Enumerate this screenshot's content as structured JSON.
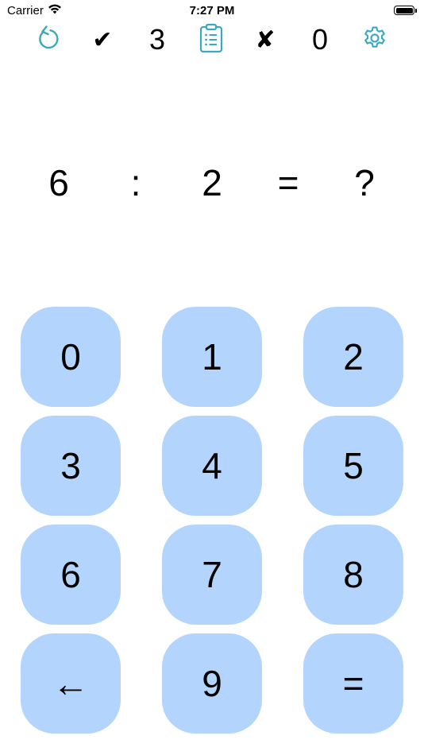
{
  "status_bar": {
    "carrier": "Carrier",
    "time": "7:27 PM",
    "icons": [
      "wifi-icon",
      "battery-icon"
    ]
  },
  "toolbar": {
    "reset_icon": "refresh-icon",
    "correct_mark": "✔",
    "correct_count": "3",
    "history_icon": "clipboard-list-icon",
    "wrong_mark": "✘",
    "wrong_count": "0",
    "settings_icon": "gear-icon",
    "accent_color": "#3aa8c1"
  },
  "equation": {
    "operand_a": "6",
    "operator": ":",
    "operand_b": "2",
    "equals": "=",
    "answer": "?"
  },
  "keypad": {
    "key_color": "#b3d5fd",
    "keys": [
      [
        "0",
        "1",
        "2"
      ],
      [
        "3",
        "4",
        "5"
      ],
      [
        "6",
        "7",
        "8"
      ],
      [
        "←",
        "9",
        "="
      ]
    ]
  }
}
